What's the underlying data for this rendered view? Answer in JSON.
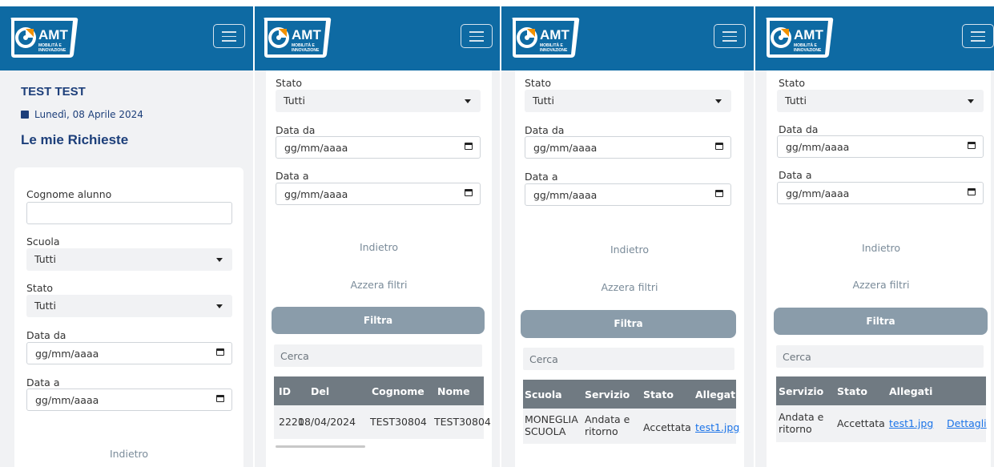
{
  "app": {
    "logo_text": "AMT",
    "logo_subtitle_1": "MOBILITÀ E",
    "logo_subtitle_2": "INNOVAZIONE",
    "brand_color": "#0e6aa3",
    "menu_icon": "hamburger-menu-icon"
  },
  "user": {
    "name": "TEST TEST",
    "date": "Lunedì, 08 Aprile 2024",
    "date_icon": "calendar-icon"
  },
  "page": {
    "title": "Le mie Richieste"
  },
  "filters": {
    "cognome_label": "Cognome alunno",
    "cognome_value": "",
    "scuola_label": "Scuola",
    "scuola_value": "Tutti",
    "stato_label": "Stato",
    "stato_value": "Tutti",
    "data_da_label": "Data da",
    "data_da_placeholder": "gg/mm/aaaa",
    "data_a_label": "Data a",
    "data_a_placeholder": "gg/mm/aaaa"
  },
  "actions": {
    "indietro": "Indietro",
    "azzera": "Azzera filtri",
    "filtra": "Filtra"
  },
  "search": {
    "placeholder": "Cerca"
  },
  "table": {
    "headers": {
      "id": "ID",
      "del": "Del",
      "cognome": "Cognome",
      "nome": "Nome",
      "scuola": "Scuola",
      "servizio": "Servizio",
      "stato": "Stato",
      "allegati": "Allegati"
    },
    "row": {
      "id": "2221",
      "del": "08/04/2024",
      "cognome": "TEST30804",
      "nome": "TEST30804",
      "scuola_1": "MONEGLIA",
      "scuola_2": "SCUOLA",
      "servizio_1": "Andata e",
      "servizio_2": "ritorno",
      "stato": "Accettata",
      "allegato": "test1.jpg",
      "dettagli": "Dettagli"
    }
  }
}
